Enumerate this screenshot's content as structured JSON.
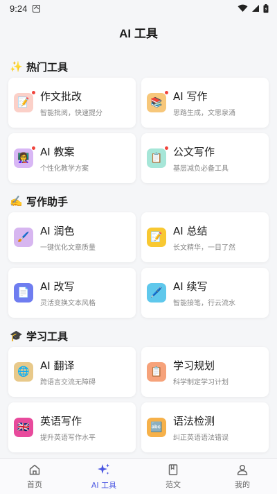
{
  "status": {
    "time": "9:24"
  },
  "header": {
    "title": "AI 工具"
  },
  "sections": [
    {
      "title": "热门工具",
      "emoji": "✨",
      "cards": [
        {
          "title": "作文批改",
          "desc": "智能批阅，快速提分",
          "icon": "📝",
          "bg": "#fbd0c8",
          "badge": true
        },
        {
          "title": "AI 写作",
          "desc": "思路生成，文思泉涌",
          "icon": "📚",
          "bg": "#f7c77a",
          "badge": true
        },
        {
          "title": "AI 教案",
          "desc": "个性化教学方案",
          "icon": "👩‍🏫",
          "bg": "#d8b7f5",
          "badge": true
        },
        {
          "title": "公文写作",
          "desc": "基层减负必备工具",
          "icon": "📋",
          "bg": "#a6e6d8",
          "badge": true
        }
      ]
    },
    {
      "title": "写作助手",
      "emoji": "✍️",
      "cards": [
        {
          "title": "AI 润色",
          "desc": "一键优化文章质量",
          "icon": "🖌️",
          "bg": "#d7b6f0",
          "badge": false
        },
        {
          "title": "AI 总结",
          "desc": "长文精华，一目了然",
          "icon": "📝",
          "bg": "#f8c832",
          "badge": false
        },
        {
          "title": "AI 改写",
          "desc": "灵活变换文本风格",
          "icon": "📄",
          "bg": "#6f7df0",
          "badge": false
        },
        {
          "title": "AI 续写",
          "desc": "智能接笔，行云流水",
          "icon": "🖊️",
          "bg": "#5fc8ec",
          "badge": false
        }
      ]
    },
    {
      "title": "学习工具",
      "emoji": "🎓",
      "cards": [
        {
          "title": "AI 翻译",
          "desc": "跨语言交流无障碍",
          "icon": "🌐",
          "bg": "#e8c98a",
          "badge": false
        },
        {
          "title": "学习规划",
          "desc": "科学制定学习计划",
          "icon": "📋",
          "bg": "#f6a27a",
          "badge": false
        },
        {
          "title": "英语写作",
          "desc": "提升英语写作水平",
          "icon": "🇬🇧",
          "bg": "#e84a9c",
          "badge": false
        },
        {
          "title": "语法检测",
          "desc": "纠正英语语法错误",
          "icon": "🔤",
          "bg": "#f6b14a",
          "badge": false
        }
      ]
    }
  ],
  "nav": [
    {
      "label": "首页",
      "icon": "home-icon",
      "active": false
    },
    {
      "label": "AI 工具",
      "icon": "sparkle-icon",
      "active": true
    },
    {
      "label": "范文",
      "icon": "book-icon",
      "active": false
    },
    {
      "label": "我的",
      "icon": "person-icon",
      "active": false
    }
  ],
  "colors": {
    "accent": "#4a56e2",
    "badge": "#f0443c",
    "background": "#f5f6f8"
  }
}
